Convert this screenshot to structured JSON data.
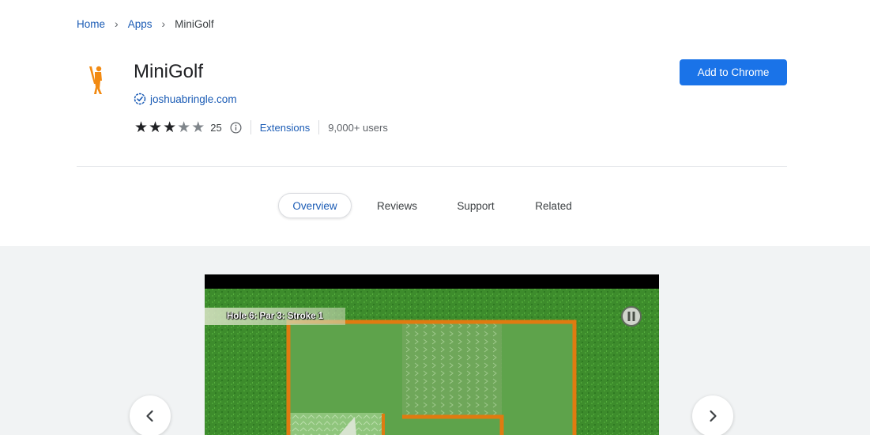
{
  "breadcrumb": {
    "home": "Home",
    "apps": "Apps",
    "current": "MiniGolf"
  },
  "app": {
    "title": "MiniGolf",
    "publisher": "joshuabringle.com",
    "rating": 3,
    "rating_max": 5,
    "rating_count": "25",
    "category": "Extensions",
    "users": "9,000+ users"
  },
  "actions": {
    "add_label": "Add to Chrome"
  },
  "tabs": [
    {
      "label": "Overview"
    },
    {
      "label": "Reviews"
    },
    {
      "label": "Support"
    },
    {
      "label": "Related"
    }
  ],
  "screenshot": {
    "hole_text": "Hole 6: Par 3: Stroke 1"
  },
  "icons": {
    "app": "golfer-icon",
    "verified": "verified-badge-icon",
    "info": "info-icon",
    "pause": "pause-icon",
    "prev": "chevron-left-icon",
    "next": "chevron-right-icon"
  },
  "colors": {
    "accent": "#1a73e8",
    "link": "#1a5bb5",
    "grass": "#3f8f2e",
    "rail": "#e07b10"
  }
}
